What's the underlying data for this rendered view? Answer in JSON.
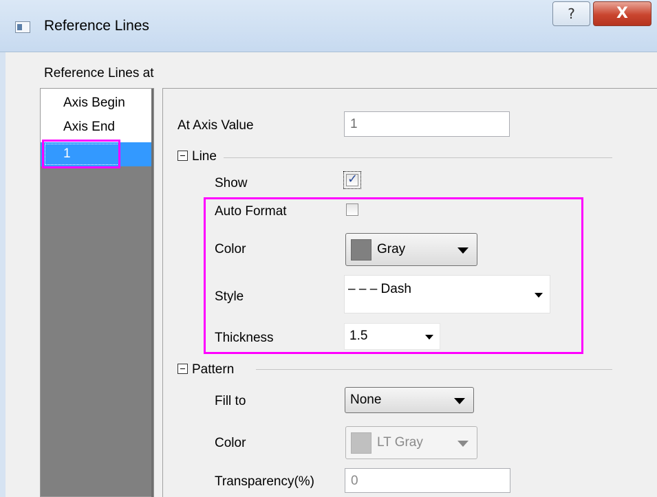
{
  "window": {
    "title": "Reference Lines",
    "help_glyph": "?",
    "close_glyph": "X"
  },
  "section_label": "Reference Lines at",
  "ref_list": {
    "items": [
      "Axis Begin",
      "Axis End",
      "1"
    ],
    "selected_index": 2
  },
  "properties": {
    "at_axis_value": {
      "label": "At Axis Value",
      "value": "1"
    },
    "line_group": {
      "title": "Line",
      "show": {
        "label": "Show",
        "checked": true
      },
      "auto_format": {
        "label": "Auto Format",
        "checked": false
      },
      "color": {
        "label": "Color",
        "value": "Gray",
        "swatch": "#808080"
      },
      "style": {
        "label": "Style",
        "value": "– – – Dash"
      },
      "thickness": {
        "label": "Thickness",
        "value": "1.5"
      }
    },
    "pattern_group": {
      "title": "Pattern",
      "fill_to": {
        "label": "Fill to",
        "value": "None"
      },
      "color": {
        "label": "Color",
        "value": "LT Gray",
        "swatch": "#c0c0c0"
      },
      "transparency": {
        "label": "Transparency(%)",
        "value": "0"
      }
    }
  },
  "annotation_color": "#ff00ff"
}
